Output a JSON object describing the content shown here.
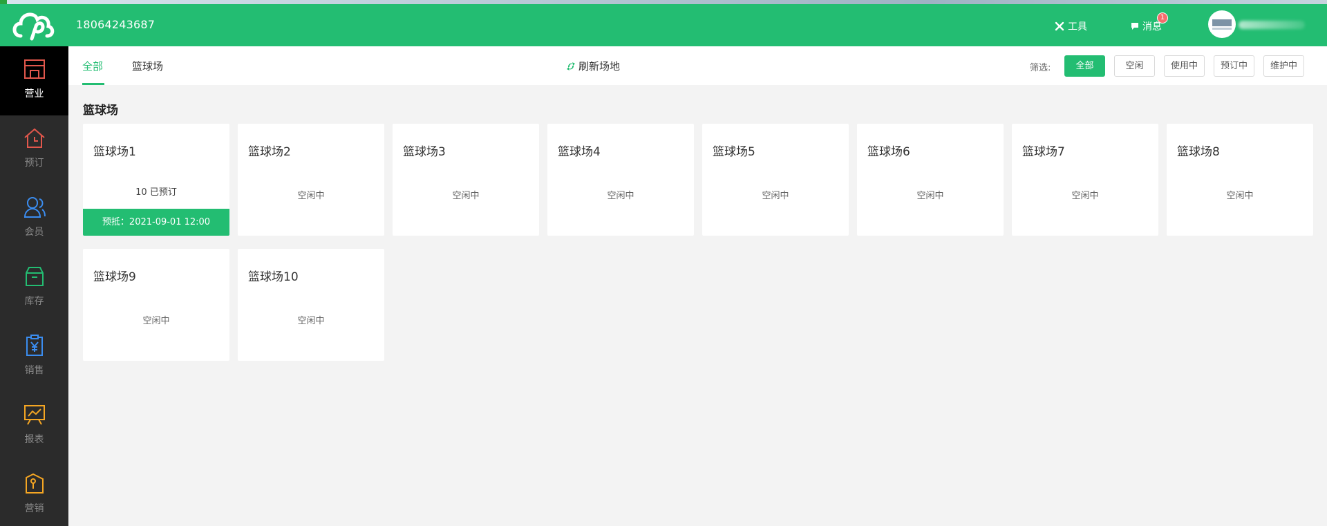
{
  "header": {
    "phone": "18064243687",
    "tools_label": "工具",
    "messages_label": "消息",
    "message_count": "1"
  },
  "sidebar": {
    "items": [
      {
        "label": "营业",
        "icon": "shop-icon",
        "color": "#e2574c",
        "active": true
      },
      {
        "label": "预订",
        "icon": "home-clock-icon",
        "color": "#e2574c"
      },
      {
        "label": "会员",
        "icon": "member-icon",
        "color": "#3b8df0"
      },
      {
        "label": "库存",
        "icon": "box-icon",
        "color": "#23bd72"
      },
      {
        "label": "销售",
        "icon": "yen-clipboard-icon",
        "color": "#3b8df0"
      },
      {
        "label": "报表",
        "icon": "chart-board-icon",
        "color": "#f5a623"
      },
      {
        "label": "营销",
        "icon": "tag-icon",
        "color": "#f5a623"
      }
    ]
  },
  "tabs": {
    "all": "全部",
    "basketball": "篮球场",
    "refresh": "刷新场地"
  },
  "filter": {
    "label": "筛选:",
    "options": [
      "全部",
      "空闲",
      "使用中",
      "预订中",
      "维护中"
    ],
    "selected": "全部"
  },
  "section_title": "篮球场",
  "courts": [
    {
      "name": "篮球场1",
      "booking": "10  已预订",
      "footer": "预抵：2021-09-01 12:00"
    },
    {
      "name": "篮球场2",
      "status": "空闲中"
    },
    {
      "name": "篮球场3",
      "status": "空闲中"
    },
    {
      "name": "篮球场4",
      "status": "空闲中"
    },
    {
      "name": "篮球场5",
      "status": "空闲中"
    },
    {
      "name": "篮球场6",
      "status": "空闲中"
    },
    {
      "name": "篮球场7",
      "status": "空闲中"
    },
    {
      "name": "篮球场8",
      "status": "空闲中"
    },
    {
      "name": "篮球场9",
      "status": "空闲中"
    },
    {
      "name": "篮球场10",
      "status": "空闲中"
    }
  ],
  "colors": {
    "brand": "#23bd72",
    "sidebar_bg": "#2b2b2b",
    "badge": "#f56c6c"
  }
}
